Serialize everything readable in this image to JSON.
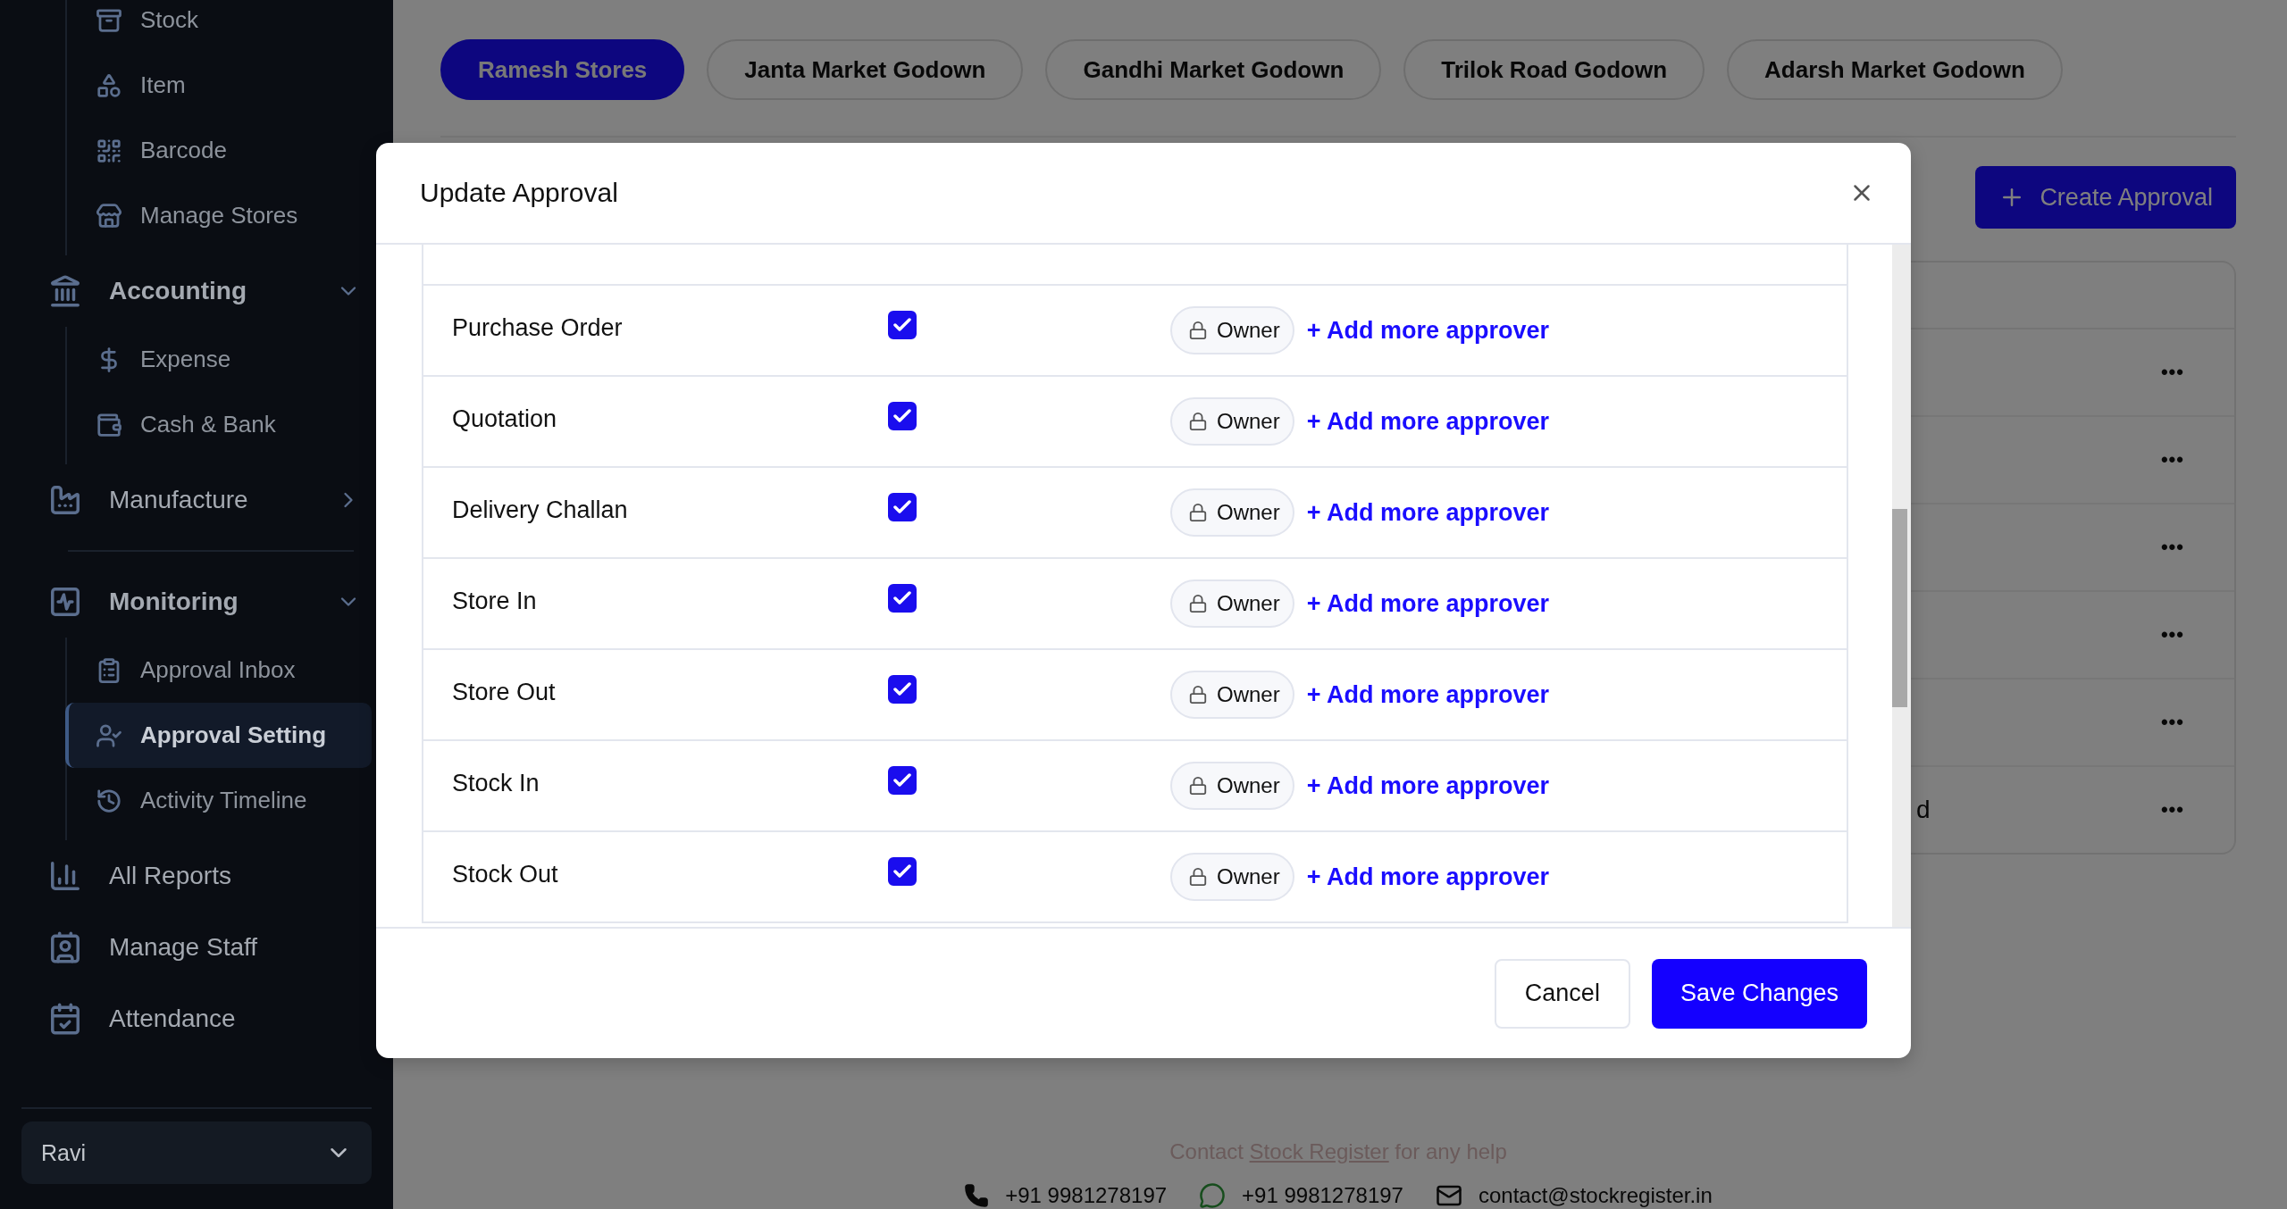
{
  "sidebar": {
    "items": [
      {
        "label": "Stock",
        "kind": "sub",
        "selected": false
      },
      {
        "label": "Item",
        "kind": "sub",
        "selected": false
      },
      {
        "label": "Barcode",
        "kind": "sub",
        "selected": false
      },
      {
        "label": "Manage Stores",
        "kind": "sub",
        "selected": false
      },
      {
        "label": "Accounting",
        "kind": "section",
        "expanded": true
      },
      {
        "label": "Expense",
        "kind": "sub",
        "selected": false
      },
      {
        "label": "Cash & Bank",
        "kind": "sub",
        "selected": false
      },
      {
        "label": "Manufacture",
        "kind": "section",
        "expanded": false
      },
      {
        "kind": "divider"
      },
      {
        "label": "Monitoring",
        "kind": "section",
        "expanded": true
      },
      {
        "label": "Approval Inbox",
        "kind": "sub",
        "selected": false
      },
      {
        "label": "Approval Setting",
        "kind": "sub",
        "selected": true
      },
      {
        "label": "Activity Timeline",
        "kind": "sub",
        "selected": false
      },
      {
        "label": "All Reports",
        "kind": "link",
        "selected": false
      },
      {
        "label": "Manage Staff",
        "kind": "link",
        "selected": false
      },
      {
        "label": "Attendance",
        "kind": "link",
        "selected": false
      }
    ],
    "user": {
      "name": "Ravi"
    }
  },
  "store_tabs": [
    {
      "label": "Ramesh Stores",
      "selected": true
    },
    {
      "label": "Janta Market Godown",
      "selected": false
    },
    {
      "label": "Gandhi Market Godown",
      "selected": false
    },
    {
      "label": "Trilok Road Godown",
      "selected": false
    },
    {
      "label": "Adarsh Market Godown",
      "selected": false
    }
  ],
  "create_button": "Create Approval",
  "approval_list": {
    "rows": [
      {
        "menu": "•••"
      },
      {
        "menu": "•••"
      },
      {
        "menu": "•••"
      },
      {
        "menu": "•••"
      },
      {
        "menu": "•••"
      },
      {
        "cell": "d",
        "menu": "•••"
      }
    ]
  },
  "footer": {
    "contact_prefix": "Contact",
    "contact_link": "Stock Register",
    "contact_suffix": "for any help",
    "phone": "+91 9981278197",
    "whatsapp": "+91 9981278197",
    "email": "contact@stockregister.in"
  },
  "modal": {
    "title": "Update Approval",
    "rows": [
      {
        "name": "Purchase Order",
        "checked": true,
        "approver": "Owner",
        "add_link": "+ Add more approver"
      },
      {
        "name": "Quotation",
        "checked": true,
        "approver": "Owner",
        "add_link": "+ Add more approver"
      },
      {
        "name": "Delivery Challan",
        "checked": true,
        "approver": "Owner",
        "add_link": "+ Add more approver"
      },
      {
        "name": "Store In",
        "checked": true,
        "approver": "Owner",
        "add_link": "+ Add more approver"
      },
      {
        "name": "Store Out",
        "checked": true,
        "approver": "Owner",
        "add_link": "+ Add more approver"
      },
      {
        "name": "Stock In",
        "checked": true,
        "approver": "Owner",
        "add_link": "+ Add more approver"
      },
      {
        "name": "Stock Out",
        "checked": true,
        "approver": "Owner",
        "add_link": "+ Add more approver"
      }
    ],
    "buttons": {
      "cancel": "Cancel",
      "save": "Save Changes"
    }
  }
}
